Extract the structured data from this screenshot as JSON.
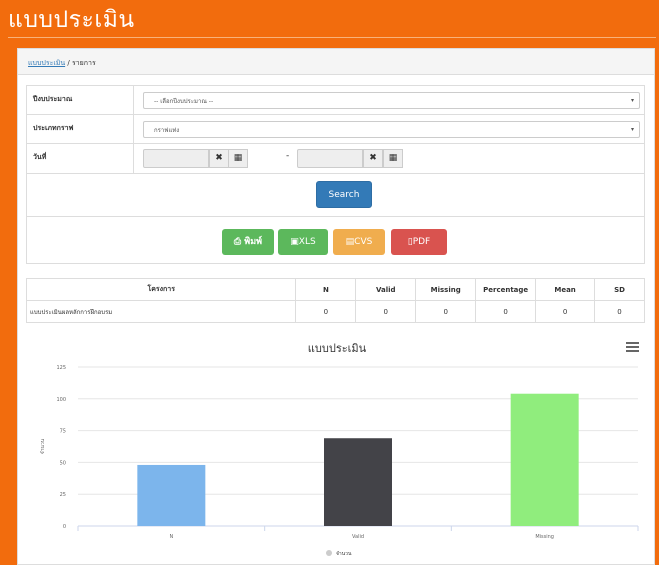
{
  "header": {
    "title": "แบบประเมิน"
  },
  "breadcrumb": {
    "link": "แบบประเมิน",
    "separator": "/",
    "current": "รายการ"
  },
  "form": {
    "fields": [
      {
        "label": "ปีงบประมาณ",
        "value": "-- เลือกปีงบประมาณ --"
      },
      {
        "label": "ประเภทกราฟ",
        "value": "กราฟแท่ง"
      },
      {
        "label": "วันที่",
        "start": "",
        "end": "",
        "separator": "-"
      }
    ],
    "search_label": "Search"
  },
  "exports": {
    "print_label": "พิมพ์",
    "xls_label": "XLS",
    "cvs_label": "CVS",
    "pdf_label": "PDF"
  },
  "table": {
    "headers": [
      "โครงการ",
      "N",
      "Valid",
      "Missing",
      "Percentage",
      "Mean",
      "SD"
    ],
    "rows": [
      [
        "แบบประเมินผลหลักการฝึกอบรม",
        "0",
        "0",
        "0",
        "0",
        "0",
        "0"
      ]
    ]
  },
  "chart_data": {
    "type": "bar",
    "title": "แบบประเมิน",
    "categories": [
      "N",
      "Valid",
      "Missing"
    ],
    "series": [
      {
        "name": "จำนวน",
        "values": [
          48,
          69,
          104
        ]
      }
    ],
    "colors": [
      "#7cb5ec",
      "#434348",
      "#90ed7d"
    ],
    "ylabel": "จำนวน",
    "ylim": [
      0,
      125
    ],
    "yticks": [
      0,
      25,
      50,
      75,
      100,
      125
    ],
    "grid": true,
    "legend": "bottom-center"
  },
  "colors": {
    "brand": "#f26c0d",
    "primary": "#337ab7",
    "success": "#5cb85c",
    "warning": "#f0ad4e",
    "danger": "#d9534f"
  }
}
